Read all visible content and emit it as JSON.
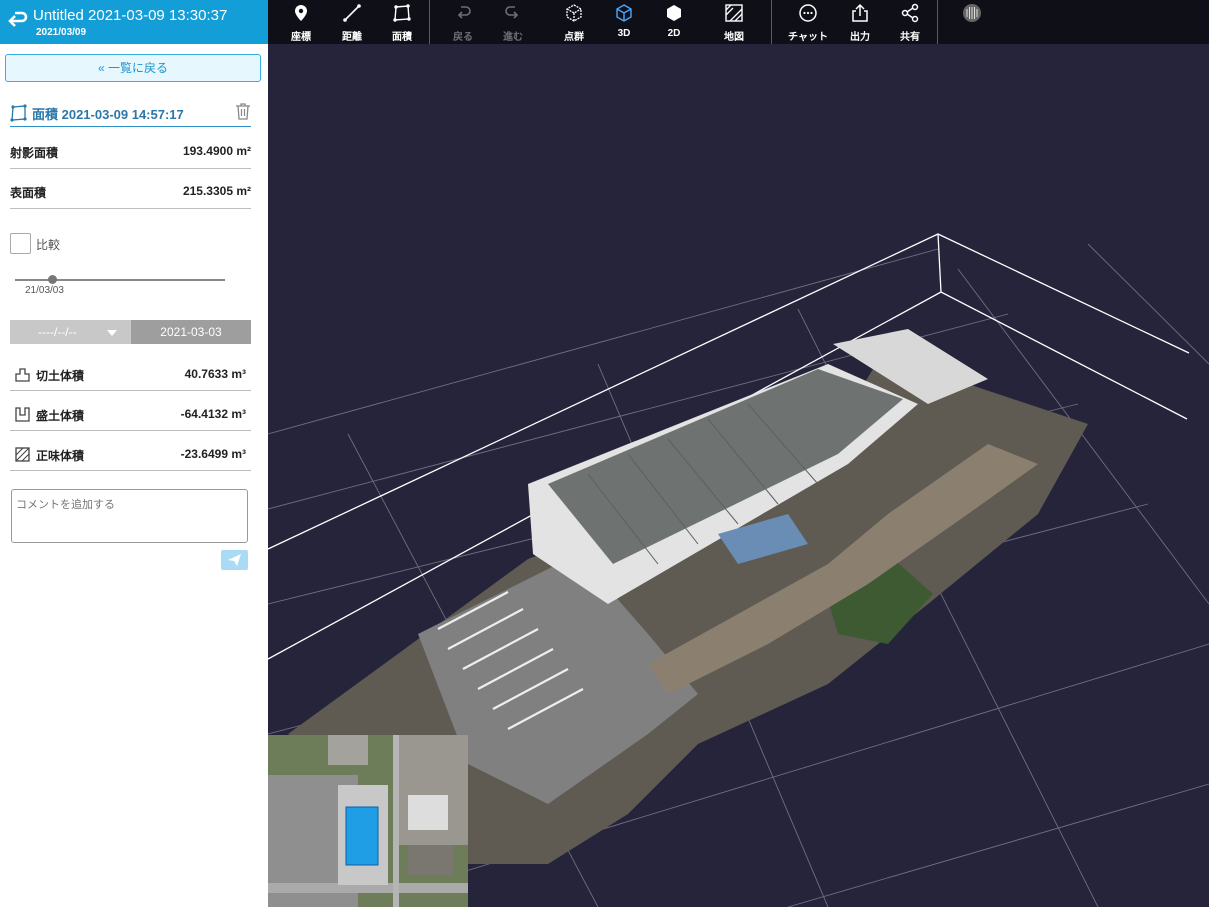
{
  "header": {
    "title": "Untitled 2021-03-09 13:30:37",
    "date": "2021/03/09"
  },
  "toolbar": {
    "coordinate": "座標",
    "distance": "距離",
    "area": "面積",
    "undo": "戻る",
    "redo": "進む",
    "pointcloud": "点群",
    "view3d": "3D",
    "view2d": "2D",
    "map": "地図",
    "chat": "チャット",
    "export": "出力",
    "share": "共有"
  },
  "panel": {
    "back_label": "« 一覧に戻る",
    "measurement_title": "面積 2021-03-09 14:57:17",
    "projected_area": {
      "label": "射影面積",
      "value": "193.4900 m²"
    },
    "surface_area": {
      "label": "表面積",
      "value": "215.3305 m²"
    },
    "compare_label": "比較",
    "slider_date": "21/03/03",
    "date_select": "----/--/--",
    "date_current": "2021-03-03",
    "cut_volume": {
      "label": "切土体積",
      "value": "40.7633 m³"
    },
    "fill_volume": {
      "label": "盛土体積",
      "value": "-64.4132 m³"
    },
    "net_volume": {
      "label": "正味体積",
      "value": "-23.6499 m³"
    },
    "comment_placeholder": "コメントを追加する"
  },
  "colors": {
    "accent": "#139ed8",
    "toolbar_bg": "#0f0f18",
    "viewer_bg": "#25243a"
  }
}
